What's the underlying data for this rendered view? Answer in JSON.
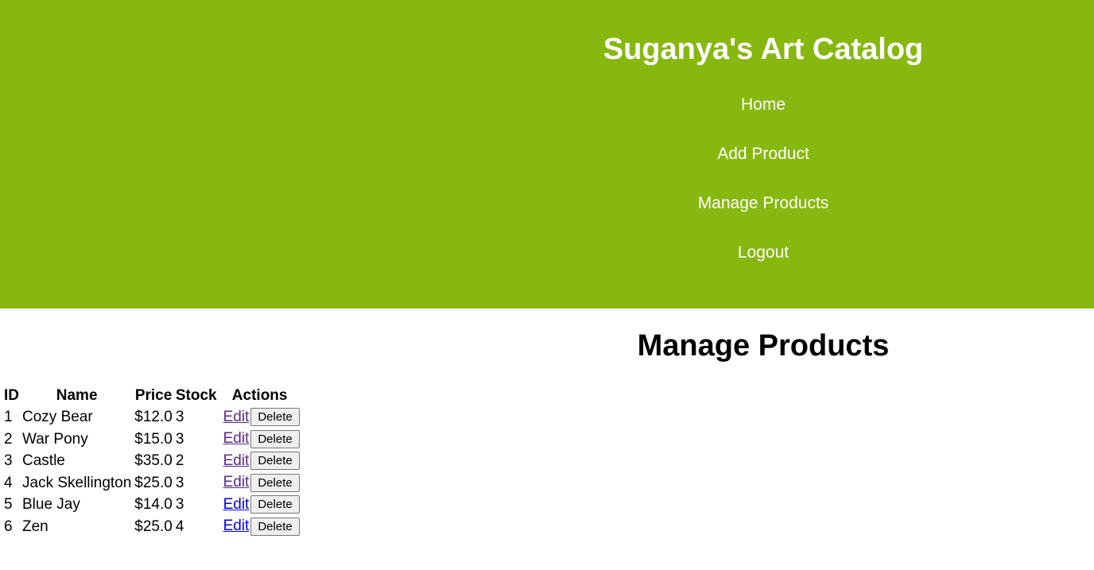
{
  "header": {
    "title": "Suganya's Art Catalog",
    "background_color": "#86b80f",
    "nav": [
      {
        "label": "Home"
      },
      {
        "label": "Add Product"
      },
      {
        "label": "Manage Products"
      },
      {
        "label": "Logout"
      }
    ]
  },
  "main": {
    "heading": "Manage Products",
    "table": {
      "columns": [
        "ID",
        "Name",
        "Price",
        "Stock",
        "Actions"
      ],
      "rows": [
        {
          "id": "1",
          "name": "Cozy Bear",
          "price": "$12.0",
          "stock": "3",
          "edit": "Edit",
          "delete": "Delete",
          "edit_visited": true
        },
        {
          "id": "2",
          "name": "War Pony",
          "price": "$15.0",
          "stock": "3",
          "edit": "Edit",
          "delete": "Delete",
          "edit_visited": true
        },
        {
          "id": "3",
          "name": "Castle",
          "price": "$35.0",
          "stock": "2",
          "edit": "Edit",
          "delete": "Delete",
          "edit_visited": true
        },
        {
          "id": "4",
          "name": "Jack Skellington",
          "price": "$25.0",
          "stock": "3",
          "edit": "Edit",
          "delete": "Delete",
          "edit_visited": true
        },
        {
          "id": "5",
          "name": "Blue Jay",
          "price": "$14.0",
          "stock": "3",
          "edit": "Edit",
          "delete": "Delete",
          "edit_visited": false
        },
        {
          "id": "6",
          "name": "Zen",
          "price": "$25.0",
          "stock": "4",
          "edit": "Edit",
          "delete": "Delete",
          "edit_visited": false
        }
      ]
    }
  }
}
